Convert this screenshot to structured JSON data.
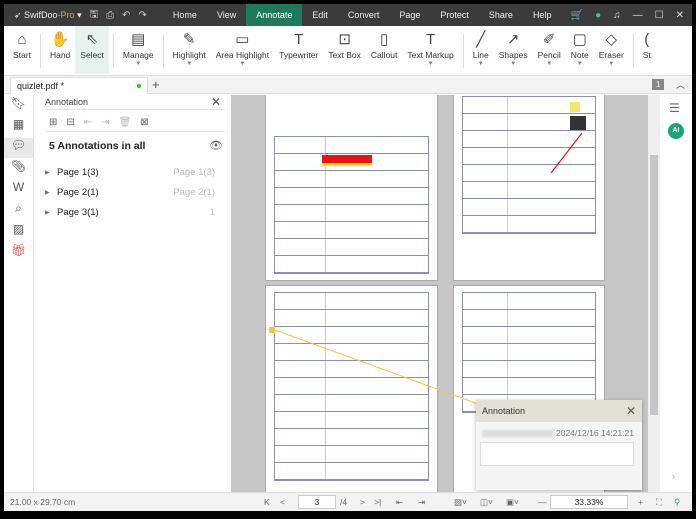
{
  "app": {
    "name": "SwifDoo",
    "edition": "-Pro"
  },
  "menu": [
    "Home",
    "View",
    "Annotate",
    "Edit",
    "Convert",
    "Page",
    "Protect",
    "Share",
    "Help"
  ],
  "menu_active": "Annotate",
  "ribbon": [
    {
      "label": "Start",
      "icon": "home-icon",
      "g": "⌂"
    },
    {
      "label": "Hand",
      "icon": "hand-icon",
      "g": "✋"
    },
    {
      "label": "Select",
      "icon": "cursor-icon",
      "g": "⇖",
      "selected": true
    },
    {
      "label": "Manage",
      "icon": "manage-icon",
      "g": "▤",
      "dd": true
    },
    {
      "label": "Highlight",
      "icon": "highlighter-icon",
      "g": "✎",
      "dd": true
    },
    {
      "label": "Area Highlight",
      "icon": "area-highlight-icon",
      "g": "▭",
      "dd": true
    },
    {
      "label": "Typewriter",
      "icon": "typewriter-icon",
      "g": "T"
    },
    {
      "label": "Text Box",
      "icon": "text-box-icon",
      "g": "⊡"
    },
    {
      "label": "Callout",
      "icon": "callout-icon",
      "g": "▯"
    },
    {
      "label": "Text Markup",
      "icon": "text-markup-icon",
      "g": "T",
      "dd": true
    },
    {
      "label": "Line",
      "icon": "line-icon",
      "g": "╱",
      "dd": true
    },
    {
      "label": "Shapes",
      "icon": "shapes-icon",
      "g": "↗",
      "dd": true
    },
    {
      "label": "Pencil",
      "icon": "pencil-icon",
      "g": "✐",
      "dd": true
    },
    {
      "label": "Note",
      "icon": "note-icon",
      "g": "▢",
      "dd": true
    },
    {
      "label": "Eraser",
      "icon": "eraser-icon",
      "g": "◇",
      "dd": true
    },
    {
      "label": "St",
      "icon": "stamp-icon",
      "g": "("
    }
  ],
  "tab": {
    "name": "quizlet.pdf *"
  },
  "page_badge": "1",
  "panel": {
    "title": "Annotation",
    "count": "5 Annotations in all",
    "groups": [
      {
        "label": "Page 1(3)",
        "right": "Page 1(3)"
      },
      {
        "label": "Page 2(1)",
        "right": "Page 2(1)"
      },
      {
        "label": "Page 3(1)",
        "right": "1"
      }
    ]
  },
  "status": {
    "size": "21.00 x 29.70 cm",
    "page": "3",
    "total": "/4",
    "zoom": "33.33%"
  },
  "popup": {
    "title": "Annotation",
    "time": "2024/12/16 14:21:21"
  },
  "colors": {
    "accent": "#1f7a5c",
    "titlebar": "#3b3b3b",
    "ai": "#1aa57a"
  }
}
